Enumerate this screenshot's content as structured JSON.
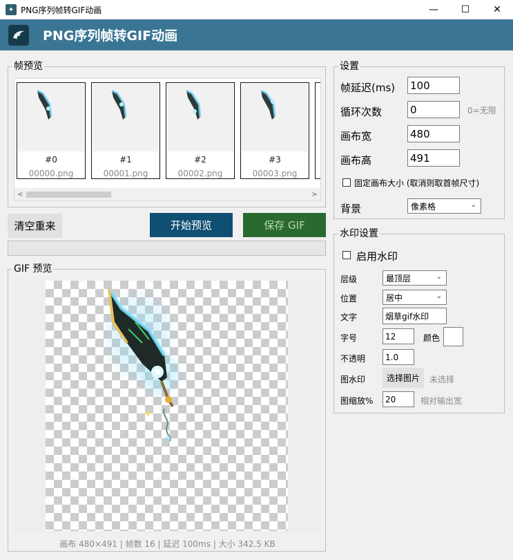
{
  "window": {
    "title": "PNG序列帧转GIF动画",
    "minimize": "—",
    "maximize": "☐",
    "close": "✕"
  },
  "banner": {
    "title": "PNG序列帧转GIF动画"
  },
  "frames": {
    "legend": "帧预览",
    "items": [
      {
        "index": "#0",
        "file": "00000.png"
      },
      {
        "index": "#1",
        "file": "00001.png"
      },
      {
        "index": "#2",
        "file": "00002.png"
      },
      {
        "index": "#3",
        "file": "00003.png"
      }
    ],
    "scroll_left": "<",
    "scroll_right": ">"
  },
  "actions": {
    "clear": "清空重来",
    "preview": "开始预览",
    "save": "保存 GIF"
  },
  "gif": {
    "legend": "GIF 预览",
    "status": "画布 480×491 | 帧数 16 | 延迟 100ms | 大小 342.5 KB"
  },
  "settings": {
    "legend": "设置",
    "delay_label": "帧延迟(ms)",
    "delay_value": "100",
    "loop_label": "循环次数",
    "loop_value": "0",
    "loop_hint": "0=无限",
    "width_label": "画布宽",
    "width_value": "480",
    "height_label": "画布高",
    "height_value": "491",
    "fixed_label": "固定画布大小 (取消则取首帧尺寸)",
    "bg_label": "背景",
    "bg_value": "像素格"
  },
  "watermark": {
    "legend": "水印设置",
    "enable_label": "启用水印",
    "layer_label": "层级",
    "layer_value": "最顶层",
    "position_label": "位置",
    "position_value": "居中",
    "text_label": "文字",
    "text_value": "烟草gif水印",
    "size_label": "字号",
    "size_value": "12",
    "color_label": "颜色",
    "opacity_label": "不透明",
    "opacity_value": "1.0",
    "image_label": "图水印",
    "image_button": "选择图片",
    "image_status": "未选择",
    "scale_label": "图缩放%",
    "scale_value": "20",
    "scale_hint": "相对输出宽"
  },
  "colors": {
    "banner": "#3a7694",
    "preview_button": "#0f4f73",
    "save_button": "#2a6a2e"
  }
}
